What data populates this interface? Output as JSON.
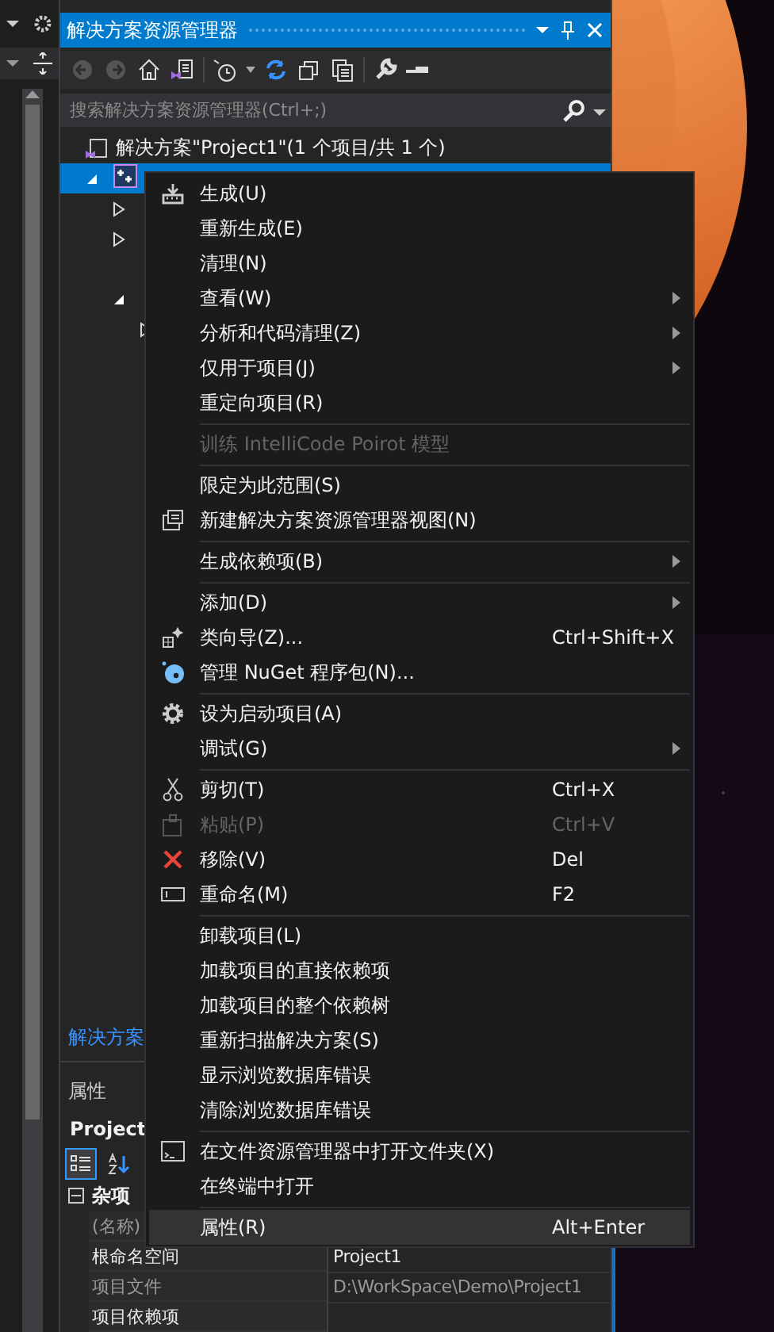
{
  "explorer": {
    "title": "解决方案资源管理器",
    "search": {
      "placeholder": "搜索解决方案资源管理器(Ctrl+;)"
    },
    "tree": [
      {
        "label": "解决方案\"Project1\"(1 个项目/共 1 个)",
        "selected": false,
        "children": [
          {
            "selected": true,
            "expanded": true,
            "children": [
              {
                "selected": false,
                "expanded": false
              },
              {
                "selected": false,
                "expanded": false
              },
              {
                "selected": false
              },
              {
                "selected": false,
                "expanded": true,
                "children": [
                  {
                    "selected": false,
                    "expanded": false
                  }
                ]
              }
            ]
          }
        ]
      }
    ],
    "bottom_link": "解决方案"
  },
  "properties": {
    "title": "属性",
    "object": "Project",
    "view_buttons": [
      {
        "selected": true
      },
      {
        "selected": false
      }
    ],
    "rows": [
      {
        "kind": "category",
        "label": "杂项",
        "expanded": true
      },
      {
        "kind": "property",
        "label": "(名称)",
        "readonly": true
      },
      {
        "kind": "property",
        "label": "根命名空间",
        "value": "Project1",
        "readonly": false
      },
      {
        "kind": "property",
        "label": "项目文件",
        "value": "D:\\WorkSpace\\Demo\\Project1",
        "readonly": true
      },
      {
        "kind": "property",
        "label": "项目依赖项",
        "readonly": false
      }
    ]
  },
  "menu": {
    "items": [
      {
        "kind": "item",
        "label": "生成(U)",
        "submenu": false,
        "disabled": false,
        "selected": false
      },
      {
        "kind": "item",
        "label": "重新生成(E)",
        "submenu": false,
        "disabled": false,
        "selected": false
      },
      {
        "kind": "item",
        "label": "清理(N)",
        "submenu": false,
        "disabled": false,
        "selected": false
      },
      {
        "kind": "item",
        "label": "查看(W)",
        "submenu": true,
        "disabled": false,
        "selected": false
      },
      {
        "kind": "item",
        "label": "分析和代码清理(Z)",
        "submenu": true,
        "disabled": false,
        "selected": false
      },
      {
        "kind": "item",
        "label": "仅用于项目(J)",
        "submenu": true,
        "disabled": false,
        "selected": false
      },
      {
        "kind": "item",
        "label": "重定向项目(R)",
        "submenu": false,
        "disabled": false,
        "selected": false
      },
      {
        "kind": "separator"
      },
      {
        "kind": "item",
        "label": "训练 IntelliCode Poirot 模型",
        "submenu": false,
        "disabled": true,
        "selected": false
      },
      {
        "kind": "separator"
      },
      {
        "kind": "item",
        "label": "限定为此范围(S)",
        "submenu": false,
        "disabled": false,
        "selected": false
      },
      {
        "kind": "item",
        "label": "新建解决方案资源管理器视图(N)",
        "submenu": false,
        "disabled": false,
        "selected": false
      },
      {
        "kind": "separator"
      },
      {
        "kind": "item",
        "label": "生成依赖项(B)",
        "submenu": true,
        "disabled": false,
        "selected": false
      },
      {
        "kind": "separator"
      },
      {
        "kind": "item",
        "label": "添加(D)",
        "submenu": true,
        "disabled": false,
        "selected": false
      },
      {
        "kind": "item",
        "label": "类向导(Z)...",
        "shortcut": "Ctrl+Shift+X",
        "submenu": false,
        "disabled": false,
        "selected": false
      },
      {
        "kind": "item",
        "label": "管理 NuGet 程序包(N)...",
        "submenu": false,
        "disabled": false,
        "selected": false
      },
      {
        "kind": "separator"
      },
      {
        "kind": "item",
        "label": "设为启动项目(A)",
        "submenu": false,
        "disabled": false,
        "selected": false
      },
      {
        "kind": "item",
        "label": "调试(G)",
        "submenu": true,
        "disabled": false,
        "selected": false
      },
      {
        "kind": "separator"
      },
      {
        "kind": "item",
        "label": "剪切(T)",
        "shortcut": "Ctrl+X",
        "submenu": false,
        "disabled": false,
        "selected": false
      },
      {
        "kind": "item",
        "label": "粘贴(P)",
        "shortcut": "Ctrl+V",
        "submenu": false,
        "disabled": true,
        "selected": false
      },
      {
        "kind": "item",
        "label": "移除(V)",
        "shortcut": "Del",
        "submenu": false,
        "disabled": false,
        "selected": false
      },
      {
        "kind": "item",
        "label": "重命名(M)",
        "shortcut": "F2",
        "submenu": false,
        "disabled": false,
        "selected": false
      },
      {
        "kind": "separator"
      },
      {
        "kind": "item",
        "label": "卸载项目(L)",
        "submenu": false,
        "disabled": false,
        "selected": false
      },
      {
        "kind": "item",
        "label": "加载项目的直接依赖项",
        "submenu": false,
        "disabled": false,
        "selected": false
      },
      {
        "kind": "item",
        "label": "加载项目的整个依赖树",
        "submenu": false,
        "disabled": false,
        "selected": false
      },
      {
        "kind": "item",
        "label": "重新扫描解决方案(S)",
        "submenu": false,
        "disabled": false,
        "selected": false
      },
      {
        "kind": "item",
        "label": "显示浏览数据库错误",
        "submenu": false,
        "disabled": false,
        "selected": false
      },
      {
        "kind": "item",
        "label": "清除浏览数据库错误",
        "submenu": false,
        "disabled": false,
        "selected": false
      },
      {
        "kind": "separator"
      },
      {
        "kind": "item",
        "label": "在文件资源管理器中打开文件夹(X)",
        "submenu": false,
        "disabled": false,
        "selected": false
      },
      {
        "kind": "item",
        "label": "在终端中打开",
        "submenu": false,
        "disabled": false,
        "selected": false
      },
      {
        "kind": "separator"
      },
      {
        "kind": "item",
        "label": "属性(R)",
        "shortcut": "Alt+Enter",
        "submenu": false,
        "disabled": false,
        "selected": true
      }
    ]
  }
}
